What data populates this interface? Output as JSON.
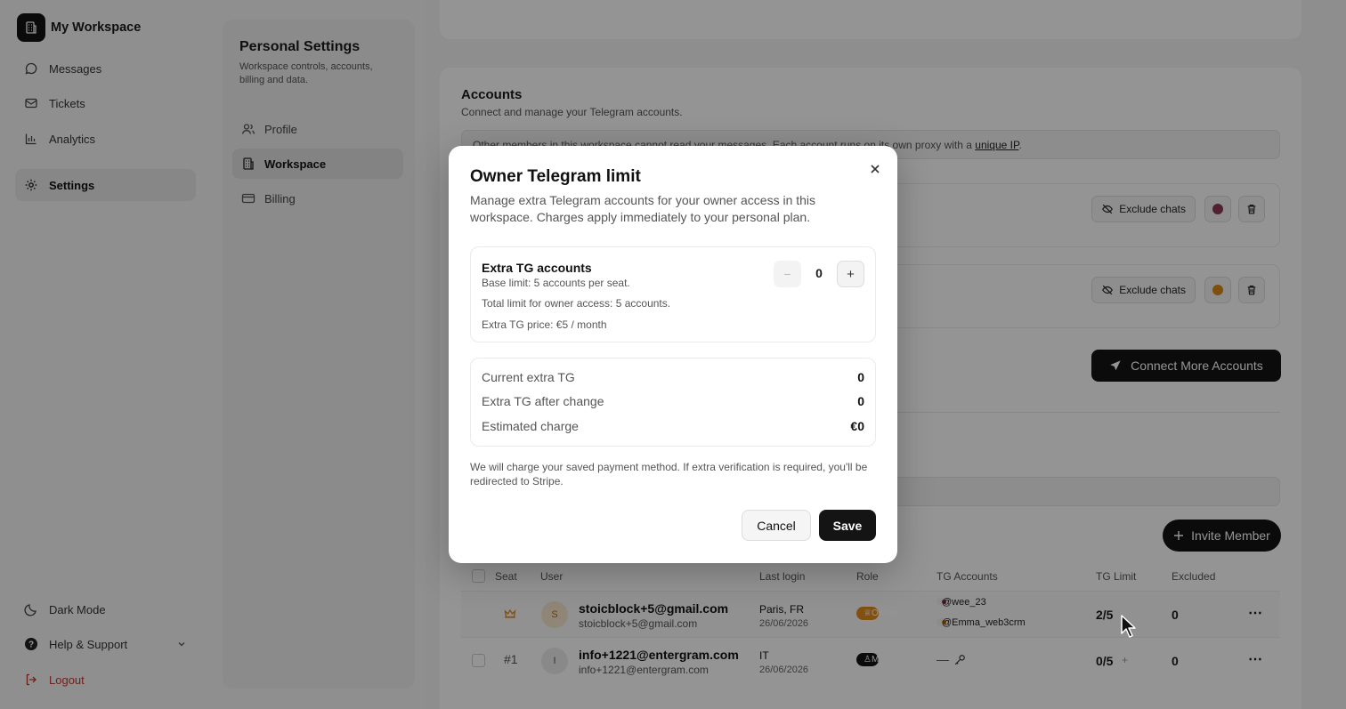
{
  "workspace": {
    "name": "My Workspace"
  },
  "nav": {
    "items": [
      {
        "label": "Messages",
        "icon": "message-icon"
      },
      {
        "label": "Tickets",
        "icon": "ticket-icon"
      },
      {
        "label": "Analytics",
        "icon": "bar-chart-icon"
      },
      {
        "label": "Settings",
        "icon": "gear-icon"
      }
    ],
    "bottom": [
      {
        "label": "Dark Mode",
        "icon": "moon-icon"
      },
      {
        "label": "Help & Support",
        "icon": "help-icon"
      },
      {
        "label": "Logout",
        "icon": "logout-icon"
      }
    ]
  },
  "settings_panel": {
    "title": "Personal Settings",
    "subtitle": "Workspace controls, accounts, billing and data.",
    "items": [
      {
        "label": "Profile",
        "icon": "user-icon"
      },
      {
        "label": "Workspace",
        "icon": "building-icon"
      },
      {
        "label": "Billing",
        "icon": "card-icon"
      }
    ]
  },
  "accounts": {
    "title": "Accounts",
    "subtitle": "Connect and manage your Telegram accounts.",
    "notice_text": "Other members in this workspace cannot read your messages. Each account runs on its own proxy with a",
    "notice_link": "unique IP",
    "notice_end": ".",
    "exclude_label": "Exclude chats",
    "dot_colors": [
      "#8a3a55",
      "#d98a1a"
    ],
    "connect_label": "Connect More Accounts"
  },
  "members": {
    "invite_label": "Invite Member",
    "columns": [
      "Seat",
      "User",
      "Last login",
      "Role",
      "TG Accounts",
      "TG Limit",
      "Excluded"
    ],
    "rows": [
      {
        "seat": "",
        "avatar": "S",
        "name": "stoicblock+5@gmail.com",
        "email": "stoicblock+5@gmail.com",
        "login_place": "Paris, FR",
        "login_date": "26/06/2026",
        "role": "Owner",
        "tg_accounts": [
          "@wee_23",
          "@Emma_web3crm"
        ],
        "tg_limit": "2/5",
        "excluded": "0"
      },
      {
        "seat": "#1",
        "avatar": "I",
        "name": "info+1221@entergram.com",
        "email": "info+1221@entergram.com",
        "login_place": "IT",
        "login_date": "26/06/2026",
        "role": "Member",
        "tg_accounts_empty": "—",
        "tg_limit": "0/5",
        "tg_limit_add": "+",
        "excluded": "0"
      }
    ]
  },
  "modal": {
    "title": "Owner Telegram limit",
    "description": "Manage extra Telegram accounts for your owner access in this workspace. Charges apply immediately to your personal plan.",
    "extra_box": {
      "title": "Extra TG accounts",
      "base_limit": "Base limit: 5 accounts per seat.",
      "total_limit": "Total limit for owner access: 5 accounts.",
      "price": "Extra TG price: €5 / month",
      "value": "0",
      "minus": "−",
      "plus": "+"
    },
    "summary": [
      {
        "label": "Current extra TG",
        "value": "0"
      },
      {
        "label": "Extra TG after change",
        "value": "0"
      },
      {
        "label": "Estimated charge",
        "value": "€0"
      }
    ],
    "note": "We will charge your saved payment method. If extra verification is required, you'll be redirected to Stripe.",
    "cancel_label": "Cancel",
    "save_label": "Save"
  },
  "colors": {
    "accent": "#141414",
    "owner_badge": "#e08a1e",
    "logout": "#c0392b",
    "overlay": "rgba(0,0,0,0.42)"
  }
}
